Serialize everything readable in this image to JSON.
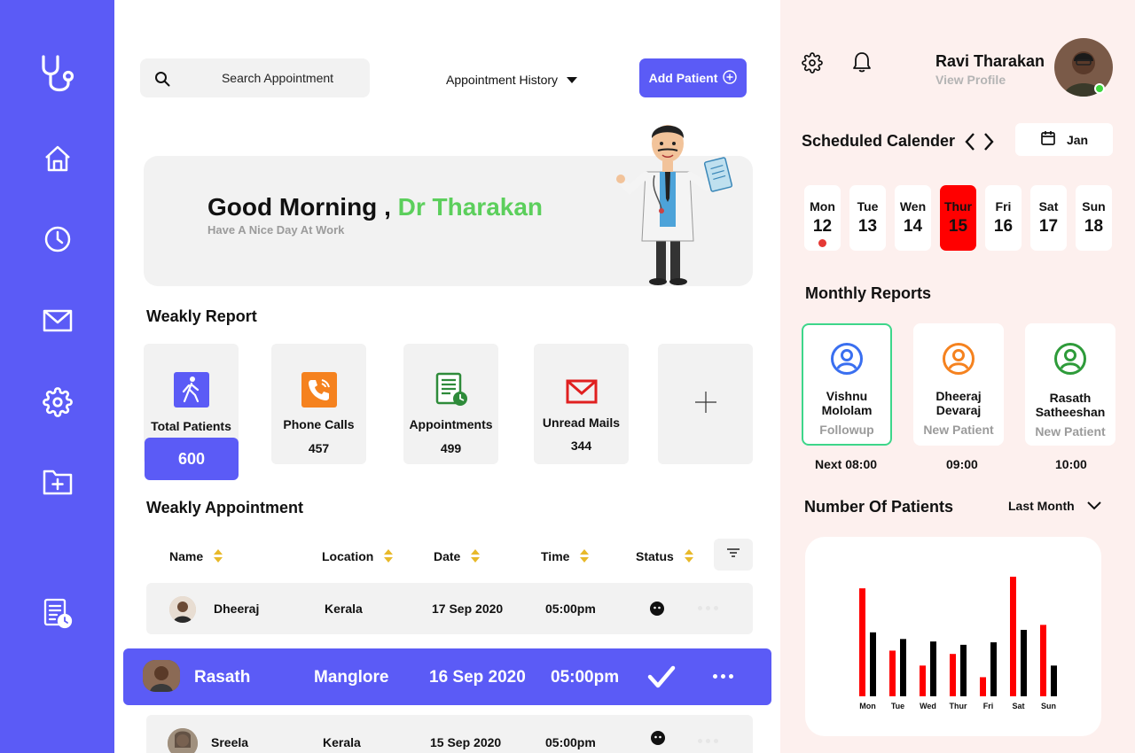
{
  "sidebar": {
    "items": [
      {
        "icon": "stethoscope-icon"
      },
      {
        "icon": "home-icon"
      },
      {
        "icon": "clock-icon"
      },
      {
        "icon": "mail-icon"
      },
      {
        "icon": "gear-icon"
      },
      {
        "icon": "folder-add-icon"
      },
      {
        "icon": "report-clock-icon"
      }
    ]
  },
  "header": {
    "search_placeholder": "Search Appointment",
    "history_label": "Appointment History",
    "add_patient_label": "Add Patient"
  },
  "banner": {
    "greeting": "Good Morning ,",
    "doctor_name": "Dr Tharakan",
    "subtitle": "Have A Nice Day At Work"
  },
  "weekly_report": {
    "title": "Weakly Report",
    "stats": [
      {
        "label": "Total Patients",
        "value": "600",
        "icon": "walking-person-icon",
        "color": "#5b5bf6"
      },
      {
        "label": "Phone Calls",
        "value": "457",
        "icon": "phone-call-icon",
        "color": "#f5821f"
      },
      {
        "label": "Appointments",
        "value": "499",
        "icon": "appointment-list-icon",
        "color": "#2e8b3a"
      },
      {
        "label": "Unread Mails",
        "value": "344",
        "icon": "envelope-icon",
        "color": "#e02020"
      }
    ]
  },
  "appointments": {
    "title": "Weakly Appointment",
    "columns": [
      "Name",
      "Location",
      "Date",
      "Time",
      "Status"
    ],
    "rows": [
      {
        "name": "Dheeraj",
        "location": "Kerala",
        "date": "17 Sep 2020",
        "time": "05:00pm"
      },
      {
        "name": "Rasath",
        "location": "Manglore",
        "date": "16 Sep 2020",
        "time": "05:00pm"
      },
      {
        "name": "Sreela",
        "location": "Kerala",
        "date": "15 Sep 2020",
        "time": "05:00pm"
      }
    ]
  },
  "profile": {
    "name": "Ravi Tharakan",
    "link": "View Profile"
  },
  "calendar": {
    "title": "Scheduled Calender",
    "month": "Jan",
    "days": [
      {
        "name": "Mon",
        "date": "12",
        "has_event": true
      },
      {
        "name": "Tue",
        "date": "13"
      },
      {
        "name": "Wen",
        "date": "14"
      },
      {
        "name": "Thur",
        "date": "15",
        "active": true
      },
      {
        "name": "Fri",
        "date": "16"
      },
      {
        "name": "Sat",
        "date": "17"
      },
      {
        "name": "Sun",
        "date": "18"
      }
    ]
  },
  "monthly_reports": {
    "title": "Monthly Reports",
    "patients": [
      {
        "name_line1": "Vishnu",
        "name_line2": "Mololam",
        "type": "Followup",
        "time": "Next  08:00",
        "color": "#3a6ff0"
      },
      {
        "name_line1": "Dheeraj",
        "name_line2": "Devaraj",
        "type": "New Patient",
        "time": "09:00",
        "color": "#f5821f"
      },
      {
        "name_line1": "Rasath",
        "name_line2": "Satheeshan",
        "type": "New Patient",
        "time": "10:00",
        "color": "#2e9b3a"
      }
    ]
  },
  "patients_chart": {
    "title": "Number Of Patients",
    "period": "Last Month"
  },
  "chart_data": {
    "type": "bar",
    "categories": [
      "Mon",
      "Tue",
      "Wed",
      "Thur",
      "Fri",
      "Sat",
      "Sun"
    ],
    "series": [
      {
        "values": [
          130,
          55,
          37,
          51,
          23,
          144,
          86
        ],
        "color": "#ff0000"
      },
      {
        "values": [
          77,
          69,
          66,
          62,
          65,
          80,
          37
        ],
        "color": "#000000"
      }
    ],
    "ylim": [
      0,
      160
    ],
    "grid": false
  }
}
